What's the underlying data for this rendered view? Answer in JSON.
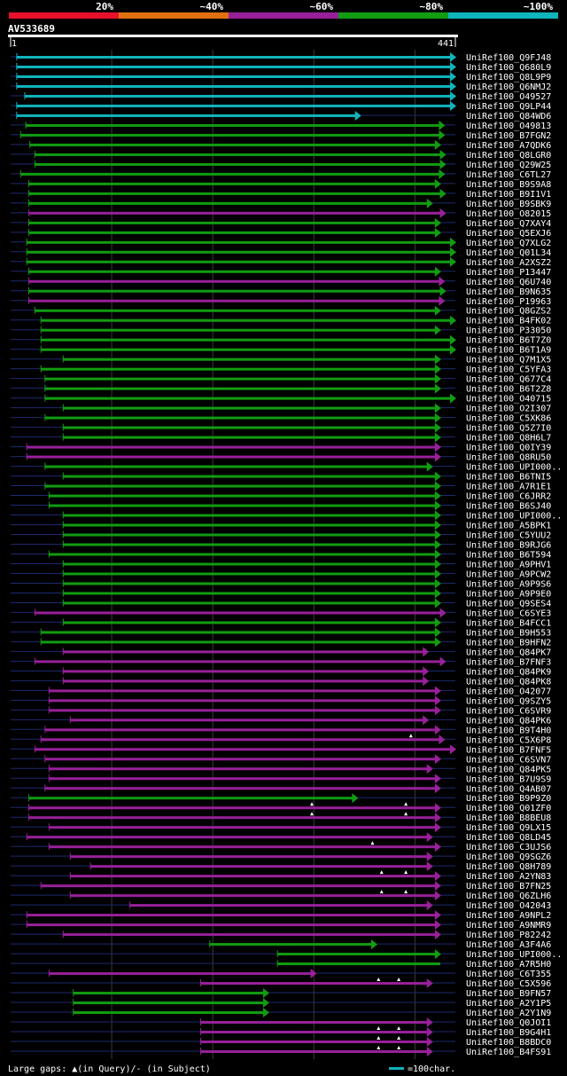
{
  "chart_data": {
    "type": "bar",
    "title": "AV533689",
    "query_length": 441,
    "axis_start_label": "1",
    "axis_end_label": "441",
    "identity_bins": [
      {
        "label": "20%",
        "color": "#e8102a"
      },
      {
        "label": "~40%",
        "color": "#e07010"
      },
      {
        "label": "~60%",
        "color": "#98209a"
      },
      {
        "label": "~80%",
        "color": "#119c11"
      },
      {
        "label": "~100%",
        "color": "#10b4bc"
      }
    ],
    "footer": {
      "gap_text": "Large gaps: ▲(in Query)/- (in Subject)",
      "scale_text": "=100char."
    },
    "rows": [
      {
        "name": "UniRef100_Q9FJ48",
        "start": 7,
        "end": 441,
        "bin": 4,
        "arrow": true,
        "gaps": []
      },
      {
        "name": "UniRef100_Q680L9",
        "start": 7,
        "end": 441,
        "bin": 4,
        "arrow": true,
        "gaps": []
      },
      {
        "name": "UniRef100_Q8L9P9",
        "start": 7,
        "end": 441,
        "bin": 4,
        "arrow": true,
        "gaps": []
      },
      {
        "name": "UniRef100_Q6NMJ2",
        "start": 7,
        "end": 441,
        "bin": 4,
        "arrow": true,
        "gaps": []
      },
      {
        "name": "UniRef100_O49527",
        "start": 15,
        "end": 441,
        "bin": 4,
        "arrow": true,
        "gaps": []
      },
      {
        "name": "UniRef100_Q9LP44",
        "start": 7,
        "end": 441,
        "bin": 4,
        "arrow": true,
        "gaps": []
      },
      {
        "name": "UniRef100_Q84WD6",
        "start": 7,
        "end": 347,
        "bin": 4,
        "arrow": true,
        "gaps": []
      },
      {
        "name": "UniRef100_O49813",
        "start": 16,
        "end": 430,
        "bin": 3,
        "arrow": true,
        "gaps": []
      },
      {
        "name": "UniRef100_B7FGN2",
        "start": 11,
        "end": 430,
        "bin": 3,
        "arrow": true,
        "gaps": []
      },
      {
        "name": "UniRef100_A7QDK6",
        "start": 20,
        "end": 426,
        "bin": 3,
        "arrow": true,
        "gaps": []
      },
      {
        "name": "UniRef100_Q8LGR0",
        "start": 25,
        "end": 431,
        "bin": 3,
        "arrow": true,
        "gaps": []
      },
      {
        "name": "UniRef100_Q29W25",
        "start": 25,
        "end": 431,
        "bin": 3,
        "arrow": true,
        "gaps": []
      },
      {
        "name": "UniRef100_C6TL27",
        "start": 11,
        "end": 430,
        "bin": 3,
        "arrow": true,
        "gaps": []
      },
      {
        "name": "UniRef100_B9S9A8",
        "start": 19,
        "end": 426,
        "bin": 3,
        "arrow": true,
        "gaps": []
      },
      {
        "name": "UniRef100_B9I1V1",
        "start": 19,
        "end": 431,
        "bin": 3,
        "arrow": true,
        "gaps": []
      },
      {
        "name": "UniRef100_B9SBK9",
        "start": 19,
        "end": 418,
        "bin": 3,
        "arrow": true,
        "gaps": []
      },
      {
        "name": "UniRef100_O82015",
        "start": 19,
        "end": 431,
        "bin": 2,
        "arrow": true,
        "gaps": []
      },
      {
        "name": "UniRef100_Q7XAY4",
        "start": 19,
        "end": 426,
        "bin": 3,
        "arrow": true,
        "gaps": []
      },
      {
        "name": "UniRef100_Q5EXJ6",
        "start": 19,
        "end": 426,
        "bin": 3,
        "arrow": true,
        "gaps": []
      },
      {
        "name": "UniRef100_Q7XLG2",
        "start": 17,
        "end": 441,
        "bin": 3,
        "arrow": true,
        "gaps": []
      },
      {
        "name": "UniRef100_Q01L34",
        "start": 17,
        "end": 441,
        "bin": 3,
        "arrow": true,
        "gaps": []
      },
      {
        "name": "UniRef100_A2XSZ2",
        "start": 17,
        "end": 441,
        "bin": 3,
        "arrow": true,
        "gaps": []
      },
      {
        "name": "UniRef100_P13447",
        "start": 19,
        "end": 426,
        "bin": 3,
        "arrow": true,
        "gaps": []
      },
      {
        "name": "UniRef100_Q6U740",
        "start": 19,
        "end": 430,
        "bin": 2,
        "arrow": true,
        "gaps": []
      },
      {
        "name": "UniRef100_B9N635",
        "start": 19,
        "end": 431,
        "bin": 3,
        "arrow": true,
        "gaps": []
      },
      {
        "name": "UniRef100_P19963",
        "start": 19,
        "end": 430,
        "bin": 2,
        "arrow": true,
        "gaps": []
      },
      {
        "name": "UniRef100_Q8GZS2",
        "start": 25,
        "end": 426,
        "bin": 3,
        "arrow": true,
        "gaps": []
      },
      {
        "name": "UniRef100_B4FK02",
        "start": 31,
        "end": 441,
        "bin": 3,
        "arrow": true,
        "gaps": []
      },
      {
        "name": "UniRef100_P33050",
        "start": 31,
        "end": 426,
        "bin": 3,
        "arrow": true,
        "gaps": []
      },
      {
        "name": "UniRef100_B6T7Z0",
        "start": 31,
        "end": 441,
        "bin": 3,
        "arrow": true,
        "gaps": []
      },
      {
        "name": "UniRef100_B6T1A9",
        "start": 31,
        "end": 441,
        "bin": 3,
        "arrow": true,
        "gaps": []
      },
      {
        "name": "UniRef100_Q7M1X5",
        "start": 53,
        "end": 426,
        "bin": 3,
        "arrow": true,
        "gaps": []
      },
      {
        "name": "UniRef100_C5YFA3",
        "start": 31,
        "end": 426,
        "bin": 3,
        "arrow": true,
        "gaps": []
      },
      {
        "name": "UniRef100_Q677C4",
        "start": 35,
        "end": 426,
        "bin": 3,
        "arrow": true,
        "gaps": []
      },
      {
        "name": "UniRef100_B6T2Z8",
        "start": 35,
        "end": 426,
        "bin": 3,
        "arrow": true,
        "gaps": []
      },
      {
        "name": "UniRef100_O40715",
        "start": 35,
        "end": 441,
        "bin": 3,
        "arrow": true,
        "gaps": []
      },
      {
        "name": "UniRef100_O2I307",
        "start": 53,
        "end": 426,
        "bin": 3,
        "arrow": true,
        "gaps": []
      },
      {
        "name": "UniRef100_C5XK86",
        "start": 35,
        "end": 426,
        "bin": 3,
        "arrow": true,
        "gaps": []
      },
      {
        "name": "UniRef100_Q5Z7I0",
        "start": 53,
        "end": 426,
        "bin": 3,
        "arrow": true,
        "gaps": []
      },
      {
        "name": "UniRef100_Q8H6L7",
        "start": 53,
        "end": 426,
        "bin": 3,
        "arrow": true,
        "gaps": []
      },
      {
        "name": "UniRef100_Q0IY39",
        "start": 17,
        "end": 426,
        "bin": 2,
        "arrow": true,
        "gaps": []
      },
      {
        "name": "UniRef100_Q8RU50",
        "start": 17,
        "end": 426,
        "bin": 2,
        "arrow": true,
        "gaps": []
      },
      {
        "name": "UniRef100_UPI000..",
        "start": 35,
        "end": 418,
        "bin": 3,
        "arrow": true,
        "gaps": []
      },
      {
        "name": "UniRef100_B6TNI5",
        "start": 53,
        "end": 426,
        "bin": 3,
        "arrow": true,
        "gaps": []
      },
      {
        "name": "UniRef100_A7R1E1",
        "start": 35,
        "end": 426,
        "bin": 3,
        "arrow": true,
        "gaps": []
      },
      {
        "name": "UniRef100_C6JRR2",
        "start": 39,
        "end": 426,
        "bin": 3,
        "arrow": true,
        "gaps": []
      },
      {
        "name": "UniRef100_B6SJ40",
        "start": 39,
        "end": 426,
        "bin": 3,
        "arrow": true,
        "gaps": []
      },
      {
        "name": "UniRef100_UPI000..",
        "start": 53,
        "end": 426,
        "bin": 3,
        "arrow": true,
        "gaps": []
      },
      {
        "name": "UniRef100_A5BPK1",
        "start": 53,
        "end": 426,
        "bin": 3,
        "arrow": true,
        "gaps": []
      },
      {
        "name": "UniRef100_C5YUU2",
        "start": 53,
        "end": 426,
        "bin": 3,
        "arrow": true,
        "gaps": []
      },
      {
        "name": "UniRef100_B9RJG6",
        "start": 53,
        "end": 426,
        "bin": 3,
        "arrow": true,
        "gaps": []
      },
      {
        "name": "UniRef100_B6T594",
        "start": 39,
        "end": 426,
        "bin": 3,
        "arrow": true,
        "gaps": []
      },
      {
        "name": "UniRef100_A9PHV1",
        "start": 53,
        "end": 426,
        "bin": 3,
        "arrow": true,
        "gaps": []
      },
      {
        "name": "UniRef100_A9PCW2",
        "start": 53,
        "end": 426,
        "bin": 3,
        "arrow": true,
        "gaps": []
      },
      {
        "name": "UniRef100_A9P9S6",
        "start": 53,
        "end": 426,
        "bin": 3,
        "arrow": true,
        "gaps": []
      },
      {
        "name": "UniRef100_A9P9E0",
        "start": 53,
        "end": 426,
        "bin": 3,
        "arrow": true,
        "gaps": []
      },
      {
        "name": "UniRef100_Q9SES4",
        "start": 53,
        "end": 426,
        "bin": 3,
        "arrow": true,
        "gaps": []
      },
      {
        "name": "UniRef100_C6SYE3",
        "start": 25,
        "end": 431,
        "bin": 2,
        "arrow": true,
        "gaps": []
      },
      {
        "name": "UniRef100_B4FCC1",
        "start": 53,
        "end": 426,
        "bin": 3,
        "arrow": true,
        "gaps": []
      },
      {
        "name": "UniRef100_B9H553",
        "start": 31,
        "end": 426,
        "bin": 3,
        "arrow": true,
        "gaps": []
      },
      {
        "name": "UniRef100_B9HFN2",
        "start": 31,
        "end": 426,
        "bin": 3,
        "arrow": true,
        "gaps": []
      },
      {
        "name": "UniRef100_Q84PK7",
        "start": 53,
        "end": 414,
        "bin": 2,
        "arrow": true,
        "gaps": []
      },
      {
        "name": "UniRef100_B7FNF3",
        "start": 25,
        "end": 431,
        "bin": 2,
        "arrow": true,
        "gaps": []
      },
      {
        "name": "UniRef100_Q84PK9",
        "start": 53,
        "end": 414,
        "bin": 2,
        "arrow": true,
        "gaps": []
      },
      {
        "name": "UniRef100_Q84PK8",
        "start": 53,
        "end": 414,
        "bin": 2,
        "arrow": true,
        "gaps": []
      },
      {
        "name": "UniRef100_O42077",
        "start": 39,
        "end": 426,
        "bin": 2,
        "arrow": true,
        "gaps": []
      },
      {
        "name": "UniRef100_Q9SZY5",
        "start": 39,
        "end": 426,
        "bin": 2,
        "arrow": true,
        "gaps": []
      },
      {
        "name": "UniRef100_C6SVR9",
        "start": 39,
        "end": 426,
        "bin": 2,
        "arrow": true,
        "gaps": []
      },
      {
        "name": "UniRef100_Q84PK6",
        "start": 60,
        "end": 414,
        "bin": 2,
        "arrow": true,
        "gaps": []
      },
      {
        "name": "UniRef100_B9T4H0",
        "start": 35,
        "end": 426,
        "bin": 2,
        "arrow": true,
        "gaps": []
      },
      {
        "name": "UniRef100_C5X6P8",
        "start": 31,
        "end": 430,
        "bin": 2,
        "arrow": true,
        "gaps": [
          397
        ]
      },
      {
        "name": "UniRef100_B7FNF5",
        "start": 25,
        "end": 441,
        "bin": 2,
        "arrow": true,
        "gaps": []
      },
      {
        "name": "UniRef100_C6SVN7",
        "start": 35,
        "end": 426,
        "bin": 2,
        "arrow": true,
        "gaps": []
      },
      {
        "name": "UniRef100_Q84PK5",
        "start": 39,
        "end": 418,
        "bin": 2,
        "arrow": true,
        "gaps": []
      },
      {
        "name": "UniRef100_B7U9S9",
        "start": 39,
        "end": 426,
        "bin": 2,
        "arrow": true,
        "gaps": []
      },
      {
        "name": "UniRef100_Q4AB07",
        "start": 35,
        "end": 426,
        "bin": 2,
        "arrow": true,
        "gaps": []
      },
      {
        "name": "UniRef100_B9P9Z0",
        "start": 19,
        "end": 344,
        "bin": 3,
        "arrow": true,
        "gaps": []
      },
      {
        "name": "UniRef100_Q01ZF0",
        "start": 19,
        "end": 426,
        "bin": 2,
        "arrow": true,
        "gaps": [
          299,
          392
        ]
      },
      {
        "name": "UniRef100_B8BEU8",
        "start": 19,
        "end": 426,
        "bin": 2,
        "arrow": true,
        "gaps": [
          299,
          392
        ]
      },
      {
        "name": "UniRef100_Q9LX15",
        "start": 39,
        "end": 426,
        "bin": 2,
        "arrow": true,
        "gaps": []
      },
      {
        "name": "UniRef100_Q8LD45",
        "start": 17,
        "end": 418,
        "bin": 2,
        "arrow": true,
        "gaps": []
      },
      {
        "name": "UniRef100_C3UJS6",
        "start": 39,
        "end": 426,
        "bin": 2,
        "arrow": true,
        "gaps": [
          359
        ]
      },
      {
        "name": "UniRef100_Q9SGZ6",
        "start": 60,
        "end": 418,
        "bin": 2,
        "arrow": true,
        "gaps": []
      },
      {
        "name": "UniRef100_Q8H789",
        "start": 80,
        "end": 418,
        "bin": 2,
        "arrow": true,
        "gaps": []
      },
      {
        "name": "UniRef100_A2YN83",
        "start": 60,
        "end": 426,
        "bin": 2,
        "arrow": true,
        "gaps": [
          368,
          392
        ]
      },
      {
        "name": "UniRef100_B7FN25",
        "start": 31,
        "end": 426,
        "bin": 2,
        "arrow": true,
        "gaps": []
      },
      {
        "name": "UniRef100_Q6ZLH6",
        "start": 60,
        "end": 426,
        "bin": 2,
        "arrow": true,
        "gaps": [
          368,
          392
        ]
      },
      {
        "name": "UniRef100_O42043",
        "start": 119,
        "end": 418,
        "bin": 2,
        "arrow": true,
        "gaps": []
      },
      {
        "name": "UniRef100_A9NPL2",
        "start": 17,
        "end": 426,
        "bin": 2,
        "arrow": true,
        "gaps": []
      },
      {
        "name": "UniRef100_A9NMR9",
        "start": 17,
        "end": 426,
        "bin": 2,
        "arrow": true,
        "gaps": []
      },
      {
        "name": "UniRef100_P82242",
        "start": 53,
        "end": 426,
        "bin": 2,
        "arrow": true,
        "gaps": []
      },
      {
        "name": "UniRef100_A3F4A6",
        "start": 198,
        "end": 363,
        "bin": 3,
        "arrow": true,
        "gaps": []
      },
      {
        "name": "UniRef100_UPI000..",
        "start": 265,
        "end": 426,
        "bin": 3,
        "arrow": true,
        "gaps": []
      },
      {
        "name": "UniRef100_A7R5H0",
        "start": 265,
        "end": 426,
        "bin": 3,
        "arrow": false,
        "gaps": []
      },
      {
        "name": "UniRef100_C6T355",
        "start": 39,
        "end": 303,
        "bin": 2,
        "arrow": true,
        "gaps": []
      },
      {
        "name": "UniRef100_C5X596",
        "start": 189,
        "end": 418,
        "bin": 2,
        "arrow": true,
        "gaps": [
          365,
          385
        ]
      },
      {
        "name": "UniRef100_B9FN57",
        "start": 63,
        "end": 256,
        "bin": 3,
        "arrow": true,
        "gaps": []
      },
      {
        "name": "UniRef100_A2Y1P5",
        "start": 63,
        "end": 256,
        "bin": 3,
        "arrow": true,
        "gaps": []
      },
      {
        "name": "UniRef100_A2Y1N9",
        "start": 63,
        "end": 256,
        "bin": 3,
        "arrow": true,
        "gaps": []
      },
      {
        "name": "UniRef100_Q0JOI1",
        "start": 189,
        "end": 418,
        "bin": 2,
        "arrow": true,
        "gaps": []
      },
      {
        "name": "UniRef100_B9G4H1",
        "start": 189,
        "end": 418,
        "bin": 2,
        "arrow": true,
        "gaps": [
          365,
          385
        ]
      },
      {
        "name": "UniRef100_B8BDC0",
        "start": 189,
        "end": 418,
        "bin": 2,
        "arrow": true,
        "gaps": [
          365,
          385
        ]
      },
      {
        "name": "UniRef100_B4FS91",
        "start": 189,
        "end": 418,
        "bin": 2,
        "arrow": true,
        "gaps": [
          365,
          385
        ]
      }
    ]
  }
}
